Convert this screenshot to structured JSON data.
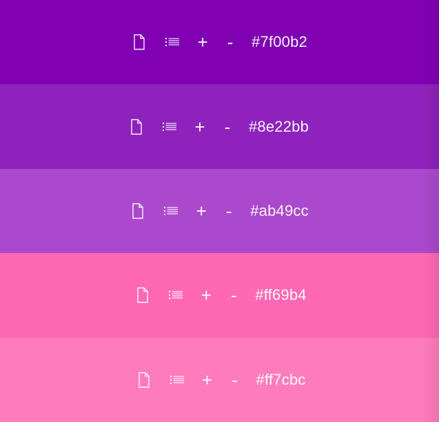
{
  "swatches": [
    {
      "background": "#7f00b2",
      "hex_label": "#7f00b2",
      "plus_label": "+",
      "minus_label": "-"
    },
    {
      "background": "#8e22bb",
      "hex_label": "#8e22bb",
      "plus_label": "+",
      "minus_label": "-"
    },
    {
      "background": "#ab49cc",
      "hex_label": "#ab49cc",
      "plus_label": "+",
      "minus_label": "-"
    },
    {
      "background": "#ff69b4",
      "hex_label": "#ff69b4",
      "plus_label": "+",
      "minus_label": "-"
    },
    {
      "background": "#ff7cbc",
      "hex_label": "#ff7cbc",
      "plus_label": "+",
      "minus_label": "-"
    }
  ],
  "icons": {
    "file_icon": "file-icon",
    "list_icon": "list-icon"
  }
}
